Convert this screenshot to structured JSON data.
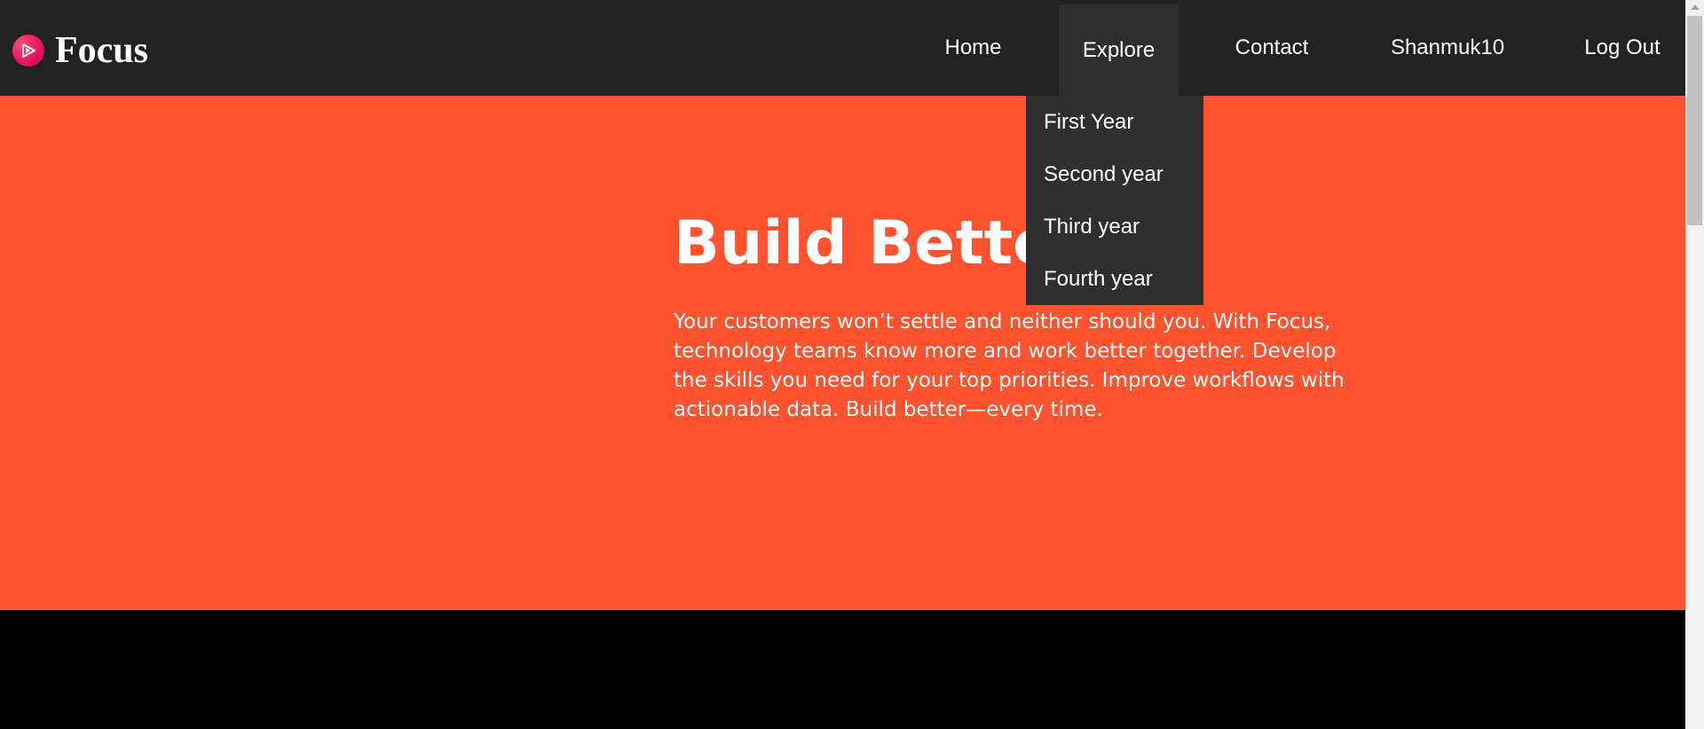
{
  "brand": {
    "name": "Focus",
    "logo_icon": "play-icon"
  },
  "nav": {
    "items": [
      {
        "label": "Home"
      },
      {
        "label": "Explore"
      },
      {
        "label": "Contact"
      },
      {
        "label": "Shanmuk10"
      },
      {
        "label": "Log Out"
      }
    ]
  },
  "dropdown": {
    "items": [
      {
        "label": "First Year"
      },
      {
        "label": "Second year"
      },
      {
        "label": "Third year"
      },
      {
        "label": "Fourth year"
      }
    ]
  },
  "hero": {
    "title": "Build Better",
    "text": "Your customers won’t settle and neither should you. With Focus, technology teams know more and work better together. Develop the skills you need for your top priorities. Improve workflows with actionable data. Build better—every time."
  },
  "colors": {
    "navbar_bg": "#222222",
    "hero_bg": "#ff522f",
    "dropdown_bg": "#2f2f2f",
    "logo_accent": "#e2135f"
  }
}
